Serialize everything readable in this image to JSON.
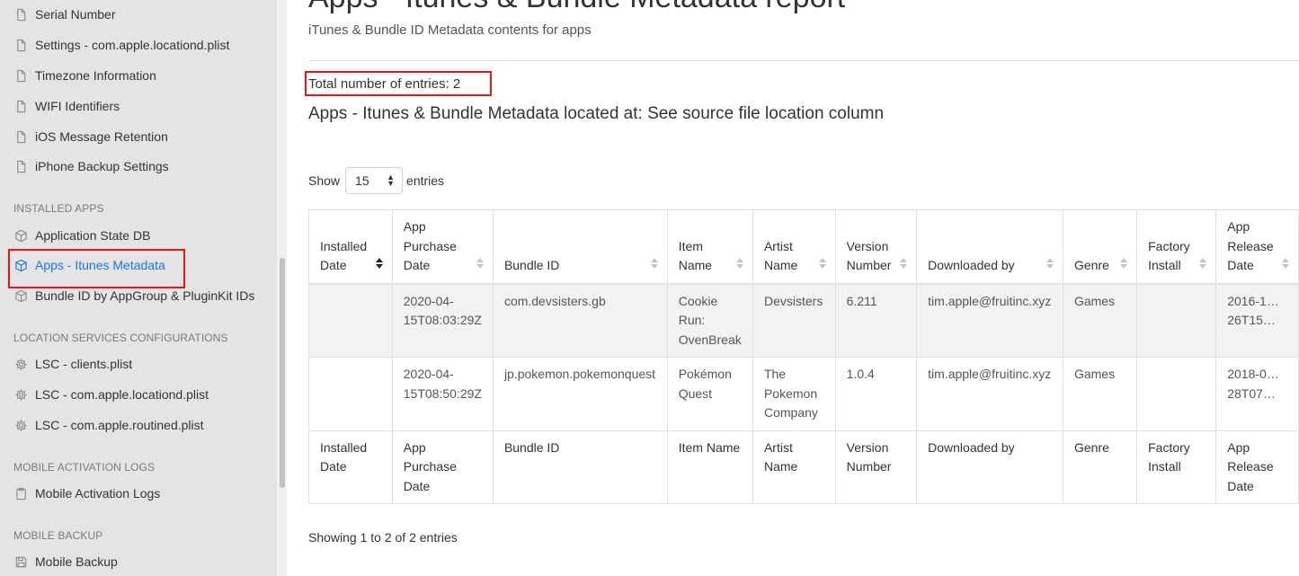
{
  "sidebar": {
    "items_top": [
      {
        "label": "Serial Number",
        "icon": "file-icon"
      },
      {
        "label": "Settings - com.apple.locationd.plist",
        "icon": "file-icon"
      },
      {
        "label": "Timezone Information",
        "icon": "file-icon"
      },
      {
        "label": "WIFI Identifiers",
        "icon": "file-icon"
      },
      {
        "label": "iOS Message Retention",
        "icon": "file-icon"
      },
      {
        "label": "iPhone Backup Settings",
        "icon": "file-icon"
      }
    ],
    "sections": {
      "installed_apps": "INSTALLED APPS",
      "location_services": "LOCATION SERVICES CONFIGURATIONS",
      "mobile_activation": "MOBILE ACTIVATION LOGS",
      "mobile_backup": "MOBILE BACKUP"
    },
    "installed_apps_items": [
      {
        "label": "Application State DB",
        "icon": "package-icon"
      },
      {
        "label": "Apps - Itunes Metadata",
        "icon": "package-icon",
        "active": true
      },
      {
        "label": "Bundle ID by AppGroup & PluginKit IDs",
        "icon": "package-icon"
      }
    ],
    "location_items": [
      {
        "label": "LSC - clients.plist",
        "icon": "gear-icon"
      },
      {
        "label": "LSC - com.apple.locationd.plist",
        "icon": "gear-icon"
      },
      {
        "label": "LSC - com.apple.routined.plist",
        "icon": "gear-icon"
      }
    ],
    "activation_items": [
      {
        "label": "Mobile Activation Logs",
        "icon": "clipboard-icon"
      }
    ],
    "backup_items": [
      {
        "label": "Mobile Backup",
        "icon": "save-icon"
      }
    ]
  },
  "main": {
    "title": "Apps - Itunes & Bundle Metadata report",
    "subtitle": "iTunes & Bundle ID Metadata contents for apps",
    "total_entries": "Total number of entries: 2",
    "located_at": "Apps - Itunes & Bundle Metadata located at: See source file location column",
    "length_prefix": "Show",
    "length_value": "15",
    "length_suffix": "entries",
    "info": "Showing 1 to 2 of 2 entries"
  },
  "table": {
    "headers": [
      "Installed Date",
      "App Purchase Date",
      "Bundle ID",
      "Item Name",
      "Artist Name",
      "Version Number",
      "Downloaded by",
      "Genre",
      "Factory Install",
      "App Release Date"
    ],
    "rows": [
      [
        "",
        "2020-04-15T08:03:29Z",
        "com.devsisters.gb",
        "Cookie Run: OvenBreak",
        "Devsisters",
        "6.211",
        "tim.apple@fruitinc.xyz",
        "Games",
        "",
        "2016-1…26T15…"
      ],
      [
        "",
        "2020-04-15T08:50:29Z",
        "jp.pokemon.pokemonquest",
        "Pokémon Quest",
        "The Pokemon Company",
        "1.0.4",
        "tim.apple@fruitinc.xyz",
        "Games",
        "",
        "2018-0…28T07…"
      ]
    ],
    "footers": [
      "Installed Date",
      "App Purchase Date",
      "Bundle ID",
      "Item Name",
      "Artist Name",
      "Version Number",
      "Downloaded by",
      "Genre",
      "Factory Install",
      "App Release Date"
    ]
  },
  "colors": {
    "accent": "#1e74e0",
    "highlight_box": "#e8141a",
    "sidebar_bg": "#e4e4e4"
  }
}
